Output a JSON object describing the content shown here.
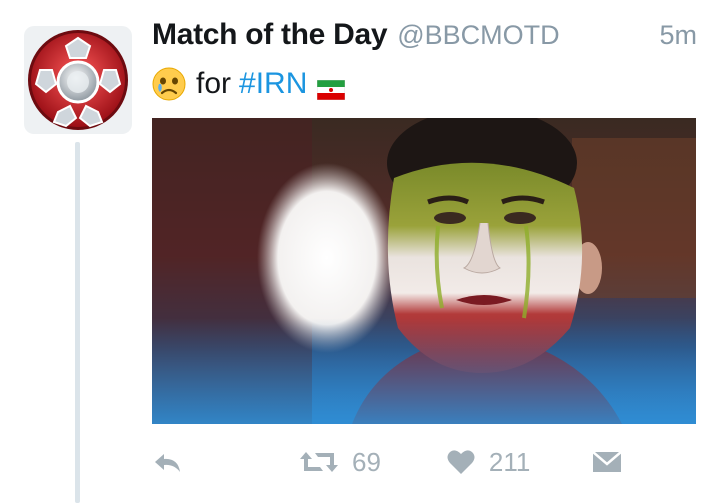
{
  "tweet": {
    "display_name": "Match of the Day",
    "handle": "@BBCMOTD",
    "time": "5m",
    "text_word": "for",
    "hashtag": "#IRN",
    "emoji_icon": "crying-face-icon",
    "flag_icon": "iran-flag-icon"
  },
  "actions": {
    "reply_icon": "reply-icon",
    "retweet_icon": "retweet-icon",
    "retweet_count": "69",
    "like_icon": "heart-icon",
    "like_count": "211",
    "message_icon": "envelope-icon"
  },
  "colors": {
    "hashtag": "#1b95e0",
    "muted": "#8899a6",
    "action": "#a4b0b8",
    "avatar_red": "#c8202a"
  }
}
